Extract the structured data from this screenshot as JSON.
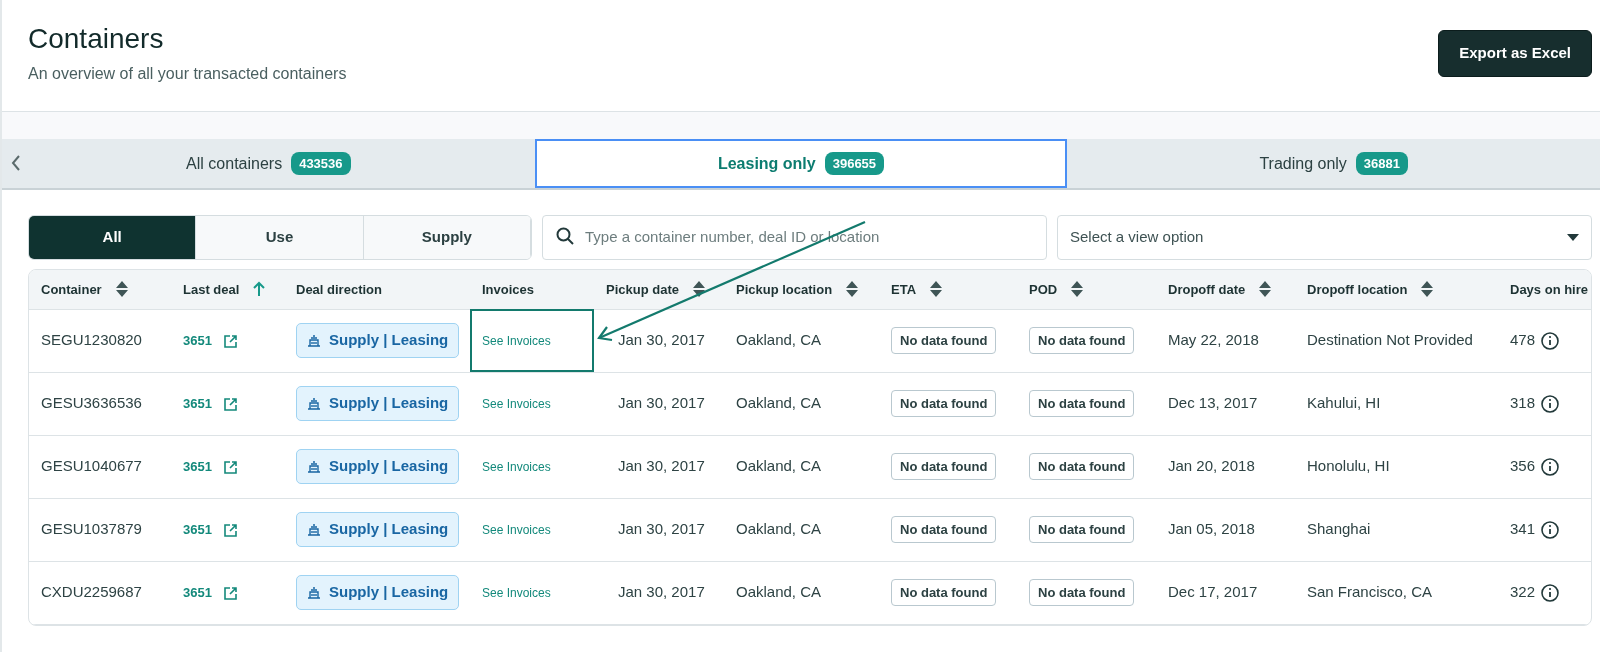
{
  "header": {
    "title": "Containers",
    "subtitle": "An overview of all your transacted containers",
    "export_button": "Export as Excel"
  },
  "tabs": [
    {
      "label": "All containers",
      "count": "433536",
      "selected": false
    },
    {
      "label": "Leasing only",
      "count": "396655",
      "selected": true
    },
    {
      "label": "Trading only",
      "count": "36881",
      "selected": false
    }
  ],
  "filters": [
    {
      "label": "All",
      "selected": true
    },
    {
      "label": "Use",
      "selected": false
    },
    {
      "label": "Supply",
      "selected": false
    }
  ],
  "search": {
    "placeholder": "Type a container number, deal ID or location"
  },
  "view_select": {
    "placeholder": "Select a view option"
  },
  "table": {
    "columns": [
      {
        "label": "Container",
        "sortable": true,
        "sorted": false
      },
      {
        "label": "Last deal",
        "sortable": true,
        "sorted": true
      },
      {
        "label": "Deal direction",
        "sortable": false,
        "sorted": false
      },
      {
        "label": "Invoices",
        "sortable": false,
        "sorted": false
      },
      {
        "label": "Pickup date",
        "sortable": true,
        "sorted": false
      },
      {
        "label": "Pickup location",
        "sortable": true,
        "sorted": false
      },
      {
        "label": "ETA",
        "sortable": true,
        "sorted": false
      },
      {
        "label": "POD",
        "sortable": true,
        "sorted": false
      },
      {
        "label": "Dropoff date",
        "sortable": true,
        "sorted": false
      },
      {
        "label": "Dropoff location",
        "sortable": true,
        "sorted": false
      },
      {
        "label": "Days on hire"
      }
    ],
    "rows": [
      {
        "container": "SEGU1230820",
        "last_deal": "3651",
        "direction": "Supply | Leasing",
        "invoices": "See Invoices",
        "pickup_date": "Jan 30, 2017",
        "pickup_location": "Oakland, CA",
        "eta": "No data found",
        "pod": "No data found",
        "dropoff_date": "May 22, 2018",
        "dropoff_location": "Destination Not Provided",
        "days": "478",
        "highlighted": true
      },
      {
        "container": "GESU3636536",
        "last_deal": "3651",
        "direction": "Supply | Leasing",
        "invoices": "See Invoices",
        "pickup_date": "Jan 30, 2017",
        "pickup_location": "Oakland, CA",
        "eta": "No data found",
        "pod": "No data found",
        "dropoff_date": "Dec 13, 2017",
        "dropoff_location": "Kahului, HI",
        "days": "318",
        "highlighted": false
      },
      {
        "container": "GESU1040677",
        "last_deal": "3651",
        "direction": "Supply | Leasing",
        "invoices": "See Invoices",
        "pickup_date": "Jan 30, 2017",
        "pickup_location": "Oakland, CA",
        "eta": "No data found",
        "pod": "No data found",
        "dropoff_date": "Jan 20, 2018",
        "dropoff_location": "Honolulu, HI",
        "days": "356",
        "highlighted": false
      },
      {
        "container": "GESU1037879",
        "last_deal": "3651",
        "direction": "Supply | Leasing",
        "invoices": "See Invoices",
        "pickup_date": "Jan 30, 2017",
        "pickup_location": "Oakland, CA",
        "eta": "No data found",
        "pod": "No data found",
        "dropoff_date": "Jan 05, 2018",
        "dropoff_location": "Shanghai",
        "days": "341",
        "highlighted": false
      },
      {
        "container": "CXDU2259687",
        "last_deal": "3651",
        "direction": "Supply | Leasing",
        "invoices": "See Invoices",
        "pickup_date": "Jan 30, 2017",
        "pickup_location": "Oakland, CA",
        "eta": "No data found",
        "pod": "No data found",
        "dropoff_date": "Dec 17, 2017",
        "dropoff_location": "San Francisco, CA",
        "days": "322",
        "highlighted": false
      }
    ]
  }
}
